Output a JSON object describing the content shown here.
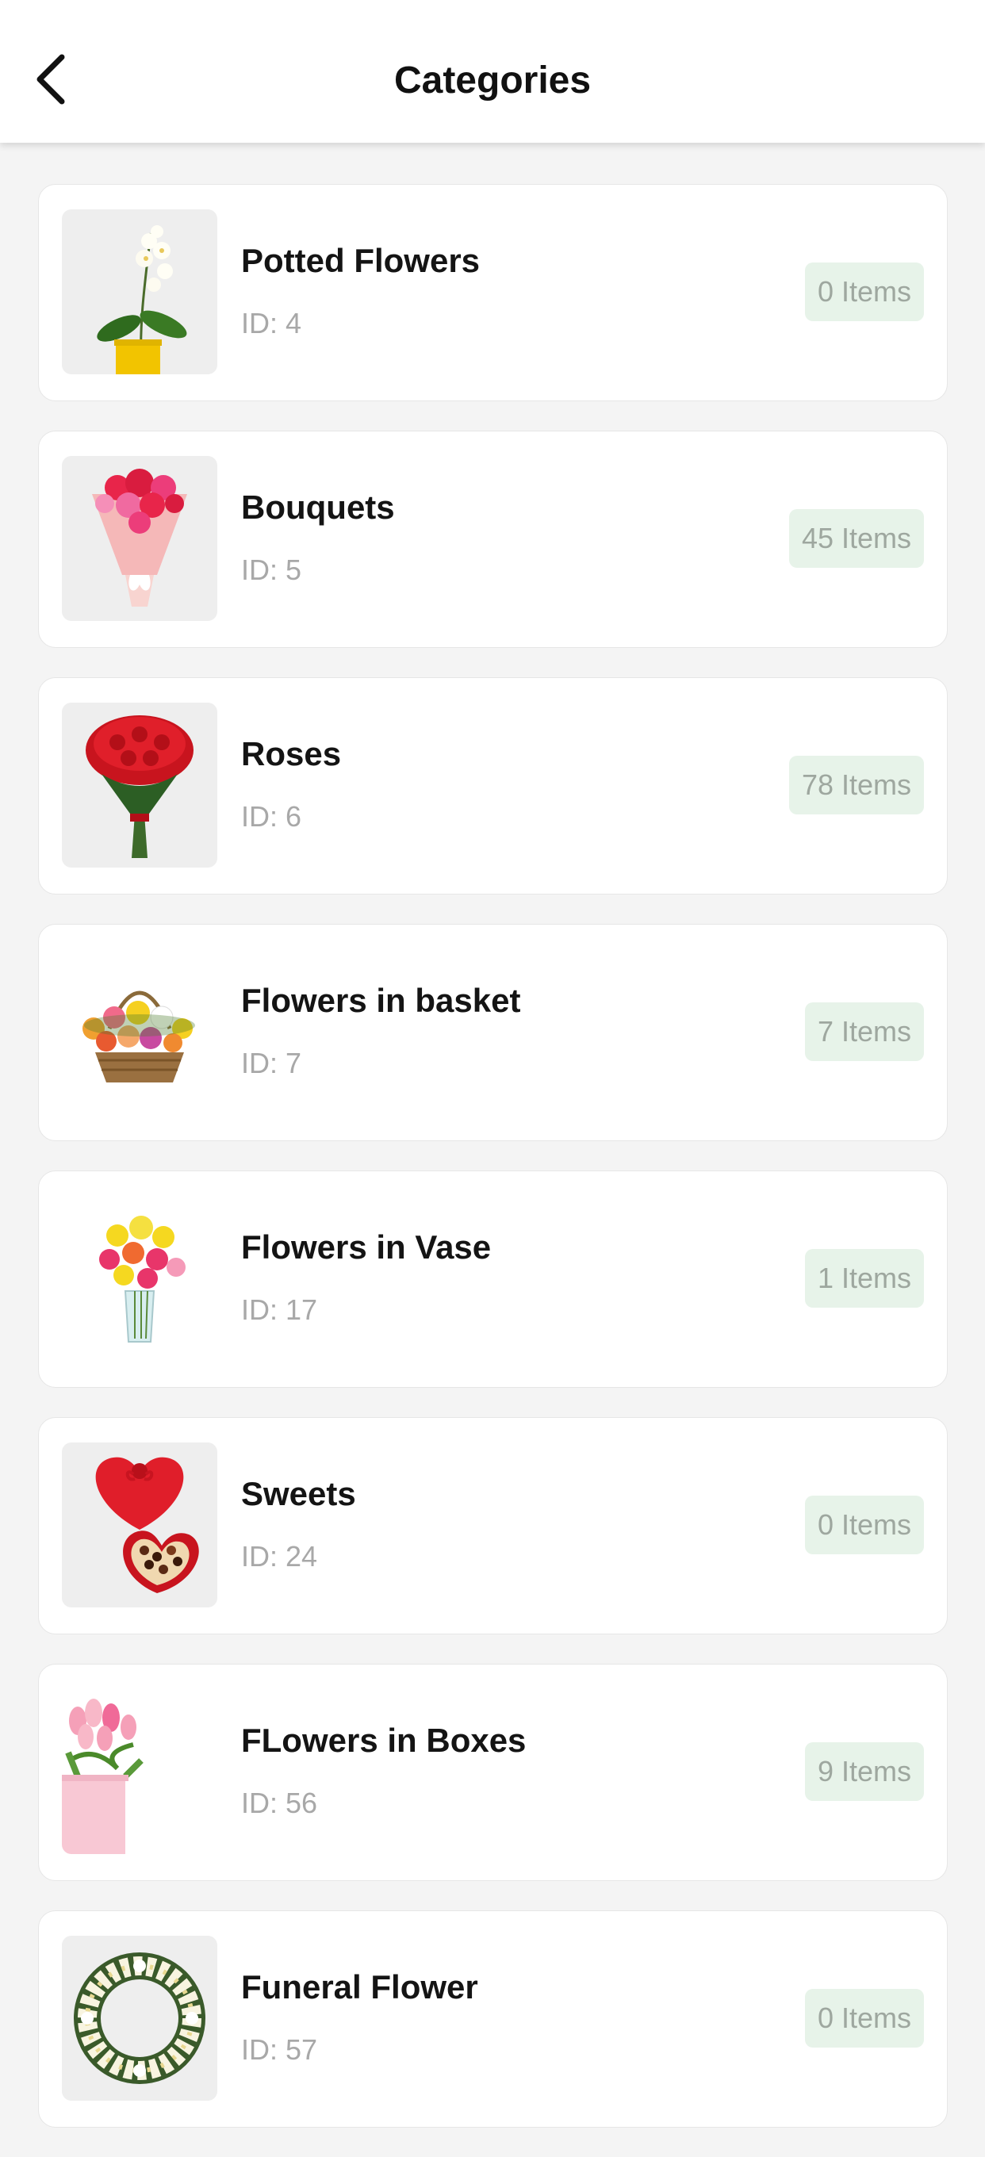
{
  "header": {
    "title": "Categories",
    "back_icon": "chevron-left-icon"
  },
  "colors": {
    "background": "#f4f4f4",
    "card": "#ffffff",
    "badge_bg": "#e7f3e9",
    "badge_text": "#9ea79f",
    "id_text": "#a8a8a8"
  },
  "categories": [
    {
      "name": "Potted Flowers",
      "id_label": "ID: 4",
      "count_label": "0 Items",
      "image": "potted-orchid-image"
    },
    {
      "name": "Bouquets",
      "id_label": "ID: 5",
      "count_label": "45 Items",
      "image": "pink-bouquet-image"
    },
    {
      "name": "Roses",
      "id_label": "ID: 6",
      "count_label": "78 Items",
      "image": "red-roses-image"
    },
    {
      "name": "Flowers in basket",
      "id_label": "ID: 7",
      "count_label": "7 Items",
      "image": "flower-basket-image"
    },
    {
      "name": "Flowers in Vase",
      "id_label": "ID: 17",
      "count_label": "1 Items",
      "image": "flowers-vase-image"
    },
    {
      "name": "Sweets",
      "id_label": "ID: 24",
      "count_label": "0 Items",
      "image": "heart-chocolate-box-image"
    },
    {
      "name": "FLowers in Boxes",
      "id_label": "ID: 56",
      "count_label": "9 Items",
      "image": "tulips-box-image"
    },
    {
      "name": "Funeral Flower",
      "id_label": "ID: 57",
      "count_label": "0 Items",
      "image": "funeral-wreath-image"
    }
  ]
}
